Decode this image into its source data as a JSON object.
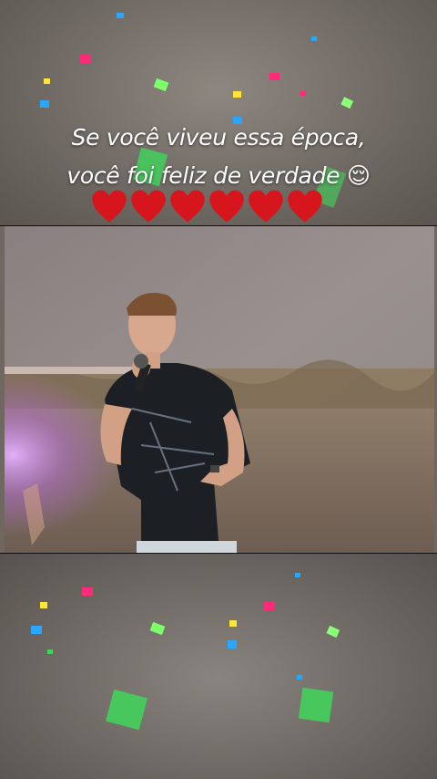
{
  "caption": {
    "line1": "Se você viveu essa época,",
    "line2": "você foi feliz de verdade",
    "emoji": "😌"
  },
  "hearts": {
    "count": 6,
    "color": "#d7151c",
    "icon": "red-heart-icon"
  },
  "video": {
    "subject": "singer-with-microphone"
  },
  "colors": {
    "background": "#6f6760",
    "text": "#ffffff"
  }
}
